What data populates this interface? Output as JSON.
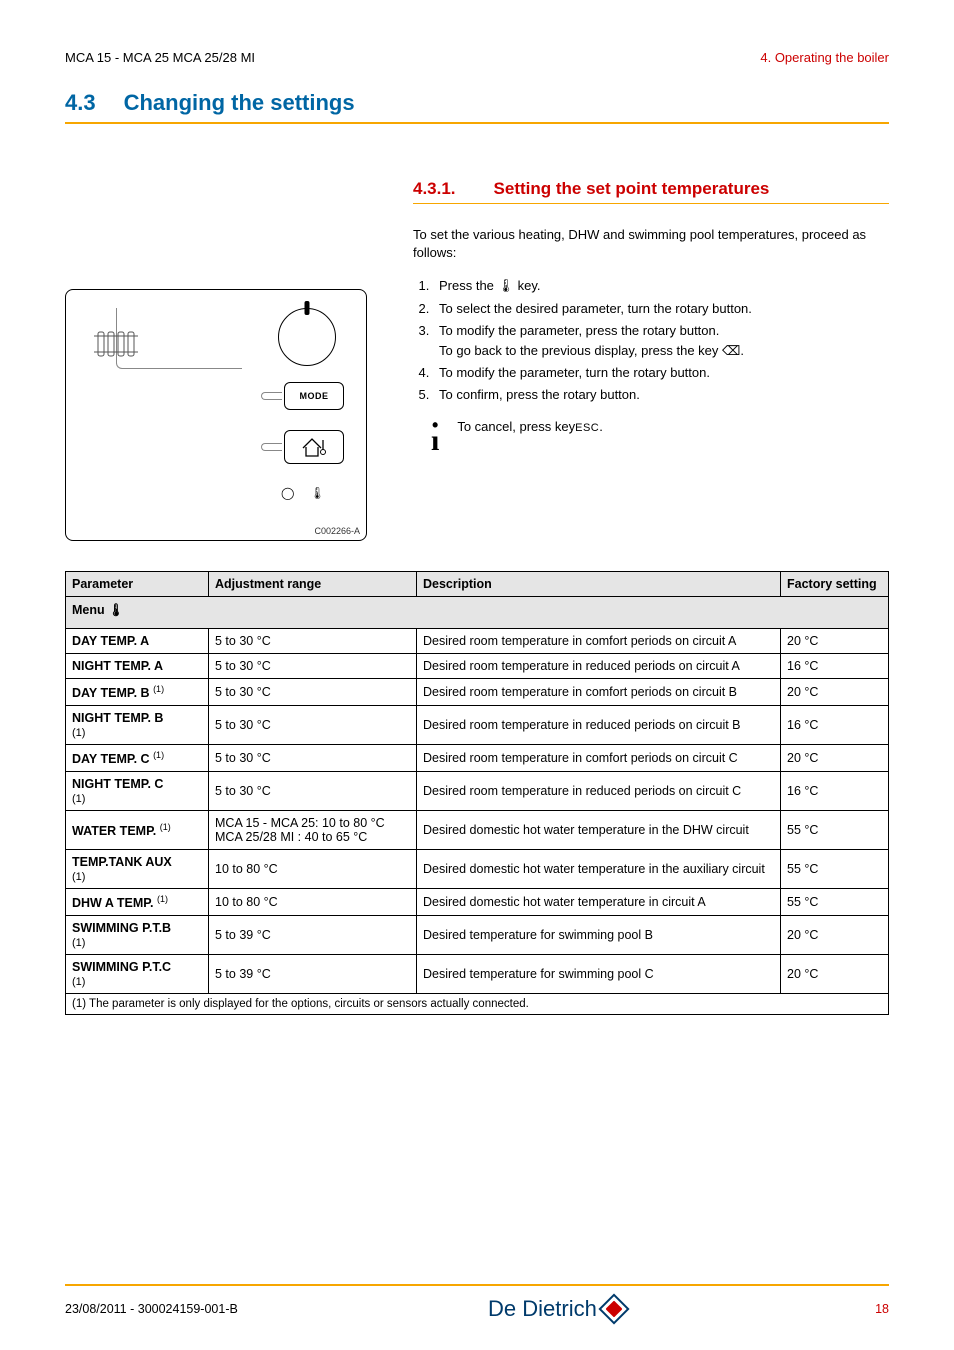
{
  "header": {
    "left": "MCA 15 - MCA 25 MCA 25/28 MI",
    "right": "4.  Operating the boiler"
  },
  "h2": {
    "num": "4.3",
    "title": "Changing the settings"
  },
  "h3": {
    "num": "4.3.1.",
    "title": "Setting the set point temperatures"
  },
  "intro": "To set the various heating, DHW and swimming pool temperatures, proceed as follows:",
  "steps": [
    "Press the 🌡 key.",
    "To select the desired parameter, turn the rotary button.",
    "To modify the parameter, press the rotary button.\nTo go back to the previous display, press the key ⌫.",
    "To modify the parameter, turn the rotary button.",
    "To confirm, press the rotary button."
  ],
  "note": "To cancel, press key",
  "note_key": "ESC",
  "figure": {
    "mode": "MODE",
    "caption": "C002266-A"
  },
  "table": {
    "title": "Menu 🌡",
    "headers": {
      "param": "Parameter",
      "range": "Adjustment range",
      "desc": "Description",
      "factory": "Factory setting"
    },
    "rows": [
      {
        "param": "DAY TEMP. A",
        "sup": "",
        "range": "5 to 30 °C",
        "desc": "Desired room temperature in comfort periods on circuit A",
        "factory": "20 °C"
      },
      {
        "param": "NIGHT TEMP. A",
        "sup": "",
        "range": "5 to 30 °C",
        "desc": "Desired room temperature in reduced periods on circuit A",
        "factory": "16 °C"
      },
      {
        "param": "DAY TEMP. B",
        "sup": "(1)",
        "range": "5 to 30 °C",
        "desc": "Desired room temperature in comfort periods on circuit B",
        "factory": "20 °C"
      },
      {
        "param": "NIGHT TEMP. B",
        "sup": "(1)",
        "sup_below": true,
        "range": "5 to 30 °C",
        "desc": "Desired room temperature in reduced periods on circuit B",
        "factory": "16 °C"
      },
      {
        "param": "DAY TEMP. C",
        "sup": "(1)",
        "range": "5 to 30 °C",
        "desc": "Desired room temperature in comfort periods on circuit C",
        "factory": "20 °C"
      },
      {
        "param": "NIGHT TEMP. C",
        "sup": "(1)",
        "sup_below": true,
        "range": "5 to 30 °C",
        "desc": "Desired room temperature in reduced periods on circuit C",
        "factory": "16 °C"
      },
      {
        "param": "WATER TEMP.",
        "sup": "(1)",
        "range": "MCA 15 - MCA 25: 10 to 80 °C\nMCA 25/28 MI : 40 to 65 °C",
        "desc": "Desired domestic hot water temperature in the DHW circuit",
        "factory": "55 °C"
      },
      {
        "param": "TEMP.TANK AUX",
        "sup": "(1)",
        "sup_below": true,
        "range": "10 to 80 °C",
        "desc": "Desired domestic hot water temperature in the auxiliary circuit",
        "factory": "55 °C"
      },
      {
        "param": "DHW A TEMP.",
        "sup": "(1)",
        "range": "10 to 80 °C",
        "desc": "Desired domestic hot water temperature in circuit A",
        "factory": "55 °C"
      },
      {
        "param": "SWIMMING P.T.B",
        "sup": "(1)",
        "sup_below": true,
        "range": "5 to 39 °C",
        "desc": "Desired temperature for swimming pool B",
        "factory": "20 °C"
      },
      {
        "param": "SWIMMING P.T.C",
        "sup": "(1)",
        "sup_below": true,
        "range": "5 to 39 °C",
        "desc": "Desired temperature for swimming pool C",
        "factory": "20 °C"
      }
    ],
    "footnote": "(1)  The parameter is only displayed for the options, circuits or sensors actually connected."
  },
  "footer": {
    "left": "23/08/2011  - 300024159-001-B",
    "brand": "De Dietrich",
    "page": "18"
  }
}
